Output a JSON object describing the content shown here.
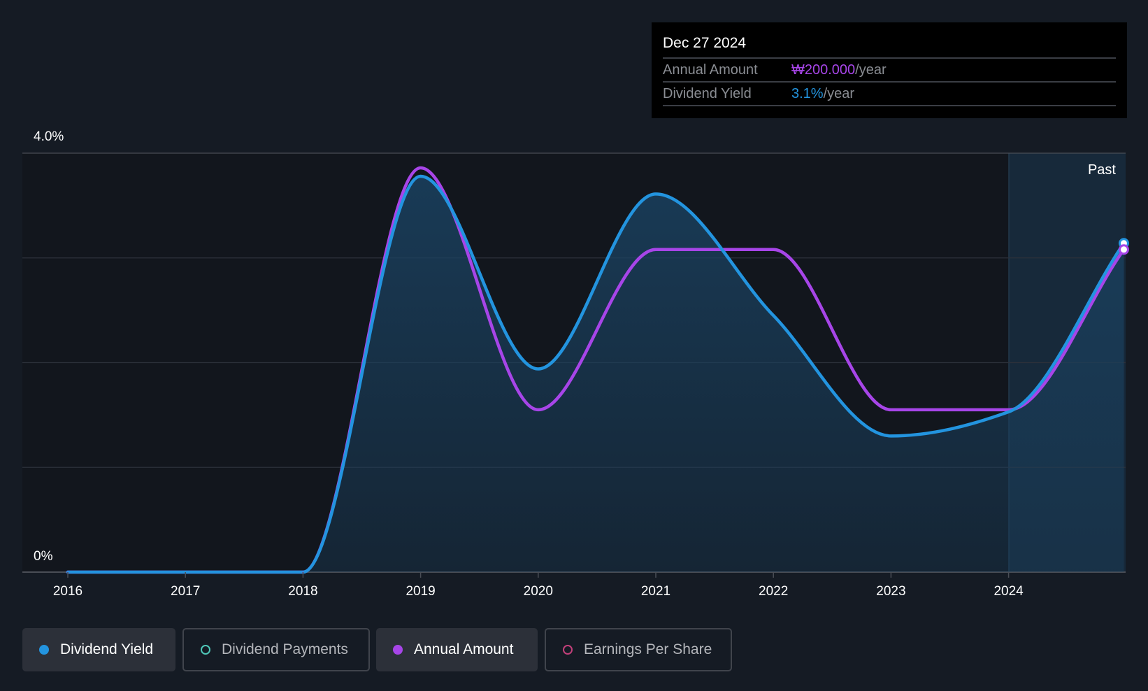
{
  "tooltip": {
    "date": "Dec 27 2024",
    "rows": [
      {
        "label": "Annual Amount",
        "value": "₩200.000",
        "unit": "/year",
        "color": "#a745e8"
      },
      {
        "label": "Dividend Yield",
        "value": "3.1%",
        "unit": "/year",
        "color": "#2394df"
      }
    ]
  },
  "legend": [
    {
      "label": "Dividend Yield",
      "active": true,
      "color": "#2394df"
    },
    {
      "label": "Dividend Payments",
      "active": false,
      "color": "#4fc7b8"
    },
    {
      "label": "Annual Amount",
      "active": true,
      "color": "#a745e8"
    },
    {
      "label": "Earnings Per Share",
      "active": false,
      "color": "#c2407a"
    }
  ],
  "chart_data": {
    "type": "line",
    "title": "",
    "xlabel": "",
    "ylabel": "",
    "x_ticks": [
      "2016",
      "2017",
      "2018",
      "2019",
      "2020",
      "2021",
      "2022",
      "2023",
      "2024"
    ],
    "xlim": [
      2015.63,
      2024.98
    ],
    "ylim": [
      0,
      4.0
    ],
    "y_tick_labels": [
      "0%",
      "4.0%"
    ],
    "grid": true,
    "region_label": "Past",
    "region_start": 2024,
    "series": [
      {
        "name": "Dividend Yield",
        "color": "#2394df",
        "unit": "%",
        "x": [
          2016,
          2018,
          2019,
          2020,
          2021,
          2022,
          2023,
          2024,
          2024.98
        ],
        "y": [
          0,
          0,
          3.78,
          1.94,
          3.61,
          2.45,
          1.3,
          1.53,
          3.14
        ]
      },
      {
        "name": "Annual Amount",
        "color": "#a745e8",
        "unit": "scaled",
        "x": [
          2016,
          2018,
          2019,
          2020,
          2021,
          2022,
          2023,
          2024,
          2024.98
        ],
        "y": [
          0,
          0,
          3.86,
          1.55,
          3.08,
          3.08,
          1.55,
          1.55,
          3.08
        ]
      }
    ]
  }
}
